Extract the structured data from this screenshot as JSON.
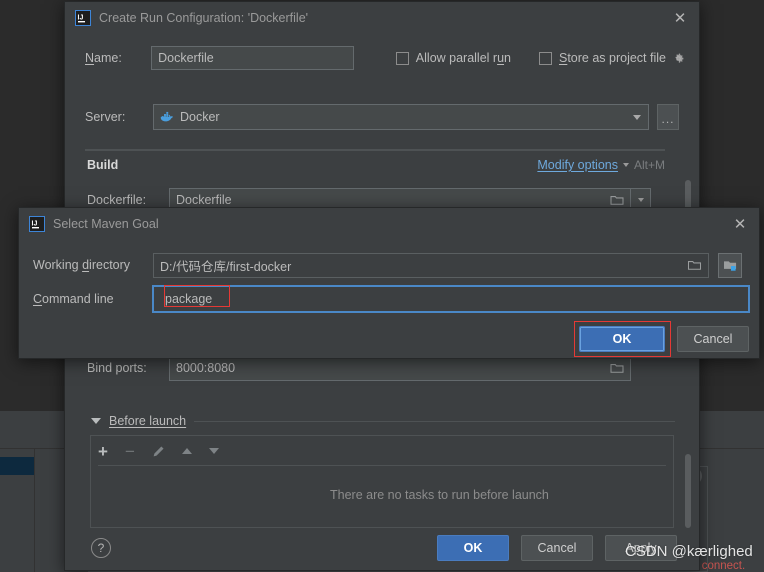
{
  "ide": {
    "bottom_hint": "Double-click on the server node to connect."
  },
  "watermark": "CSDN @kærlighed",
  "run_config_dialog": {
    "title": "Create Run Configuration: 'Dockerfile'",
    "app_icon": "intellij-idea-icon",
    "close_icon": "close-icon",
    "name_label": "Name:",
    "name_value": "Dockerfile",
    "allow_parallel_run_label": "Allow parallel run",
    "allow_parallel_run_checked": false,
    "store_as_project_file_label": "Store as project file",
    "store_as_project_file_checked": false,
    "gear_icon": "gear-icon",
    "server_label": "Server:",
    "server_value": "Docker",
    "server_icon": "docker-icon",
    "server_browse_label": "...",
    "build_section_title": "Build",
    "modify_options_label": "Modify options",
    "modify_options_shortcut": "Alt+M",
    "dockerfile_label": "Dockerfile:",
    "dockerfile_value": "Dockerfile",
    "bind_ports_label": "Bind ports:",
    "bind_ports_value": "8000:8080",
    "before_launch_label": "Before launch",
    "before_launch_empty": "There are no tasks to run before launch",
    "toolbar": {
      "add": "+",
      "remove": "−",
      "edit_icon": "pencil-icon",
      "move_up_icon": "arrow-up-icon",
      "move_down_icon": "arrow-down-icon"
    },
    "help_label": "?",
    "ok_label": "OK",
    "cancel_label": "Cancel",
    "apply_label": "Apply"
  },
  "maven_goal_dialog": {
    "title": "Select Maven Goal",
    "app_icon": "intellij-idea-icon",
    "close_icon": "close-icon",
    "working_directory_label": "Working directory",
    "working_directory_value": "D:/代码仓库/first-docker",
    "browse_folder_icon": "folder-icon",
    "module_folder_icon": "folder-module-icon",
    "command_line_label": "Command line",
    "command_line_value": "package",
    "command_line_placeholder": "",
    "ok_label": "OK",
    "cancel_label": "Cancel"
  },
  "colors": {
    "dialog_bg": "#3c3f41",
    "field_bg": "#45494a",
    "accent_blue": "#3c6eb4",
    "focus_blue": "#4a88c7",
    "highlight_red": "#e53935",
    "link_blue": "#6ea9dd",
    "error_red": "#c75450"
  }
}
